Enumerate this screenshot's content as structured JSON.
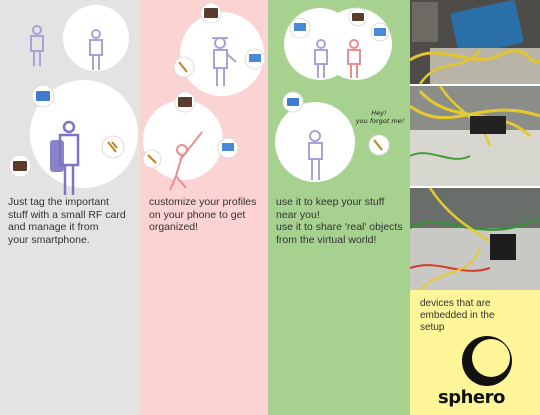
{
  "panels": [
    {
      "caption": "Just tag the important\nstuff with a small RF card\nand manage it from\nyour smartphone.",
      "color": "#e3e3e3"
    },
    {
      "caption": "customize your profiles\non your phone to get\norganized!",
      "color": "#fbd3d3"
    },
    {
      "caption": "use it to keep your stuff\nnear you!\nuse it to share 'real' objects\nfrom the virtual world!",
      "color": "#a6d18f"
    },
    {
      "caption": "devices that are\nembedded in the\nsetup",
      "color": "#fff69a"
    }
  ],
  "speech": {
    "text": "Hey!\nyou forgot me!"
  },
  "brand": {
    "name": "sphero"
  },
  "icons": [
    "person-icon",
    "phone-icon",
    "keys-icon",
    "wallet-icon",
    "laptop-icon",
    "backpack-icon",
    "book-icon",
    "speech-bubble-icon",
    "arduino-board-icon",
    "breadboard-icon",
    "sphero-logo-icon"
  ]
}
